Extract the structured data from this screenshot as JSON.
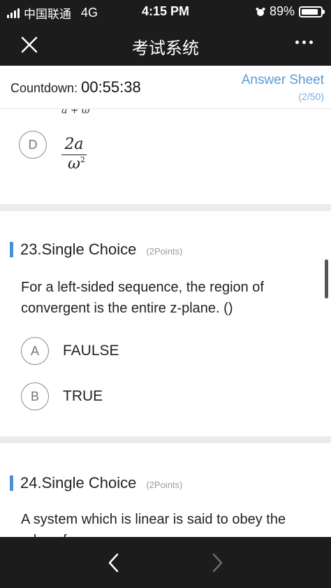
{
  "status_bar": {
    "carrier": "中国联通",
    "network": "4G",
    "time": "4:15 PM",
    "battery": "89%",
    "battery_level": 0.89
  },
  "nav": {
    "title": "考试系统"
  },
  "info": {
    "countdown_label": "Countdown:",
    "countdown_value": "00:55:38",
    "answer_sheet_label": "Answer Sheet",
    "answer_sheet_progress": "(2/50)"
  },
  "prev_question": {
    "partial_text": "a + ω",
    "option_d": {
      "letter": "D",
      "numerator": "2a",
      "denominator": "ω",
      "exponent": "2"
    }
  },
  "question_23": {
    "title": "23.Single Choice",
    "points": "(2Points)",
    "body": "For a left-sided sequence, the region of convergent is the entire z-plane. ()",
    "options": [
      {
        "letter": "A",
        "text": "FAULSE"
      },
      {
        "letter": "B",
        "text": "TRUE"
      }
    ]
  },
  "question_24": {
    "title": "24.Single Choice",
    "points": "(2Points)",
    "body": "A system which is linear is said to obey the rules of"
  },
  "colors": {
    "accent": "#4a90d9",
    "link": "#5b9bd5",
    "dark_bar": "#1c1c1c"
  }
}
